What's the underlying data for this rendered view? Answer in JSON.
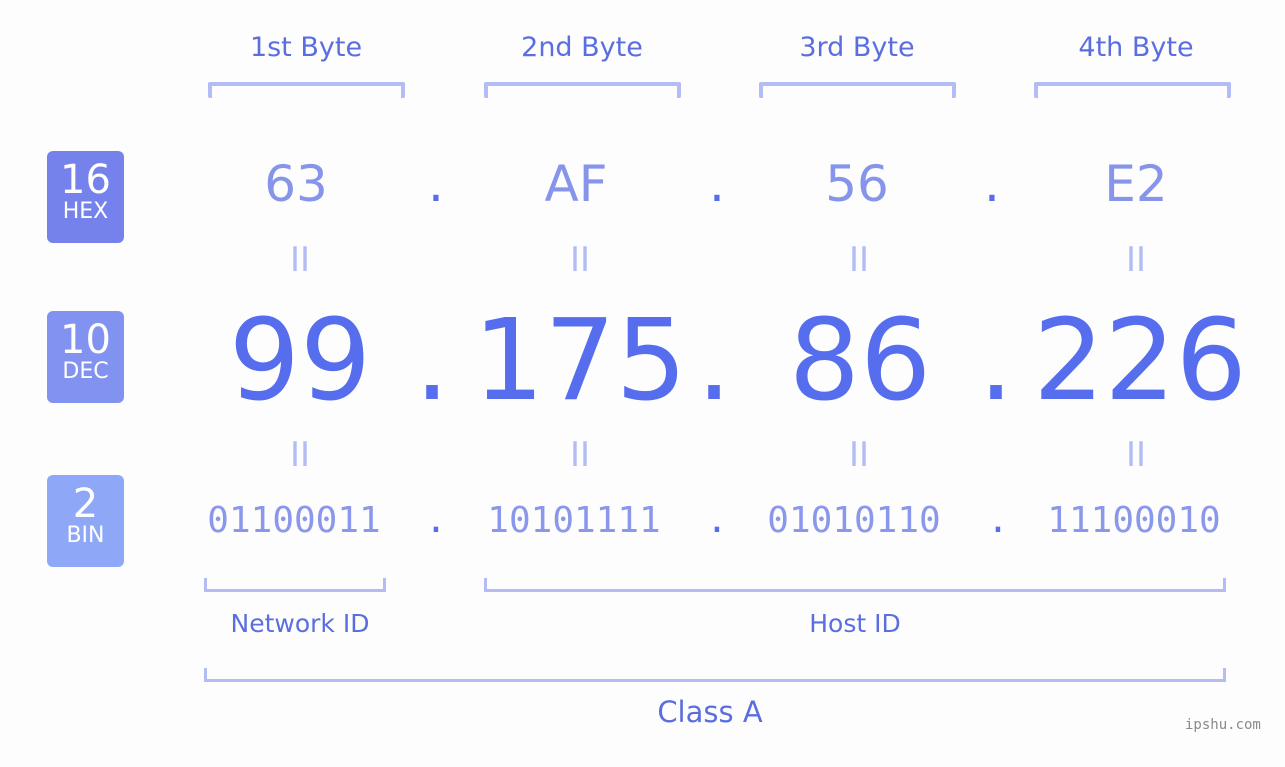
{
  "byte_headers": [
    "1st Byte",
    "2nd Byte",
    "3rd Byte",
    "4th Byte"
  ],
  "badges": [
    {
      "num": "16",
      "label": "HEX",
      "color": "#7582eb"
    },
    {
      "num": "10",
      "label": "DEC",
      "color": "#8292f0"
    },
    {
      "num": "2",
      "label": "BIN",
      "color": "#8fa7f7"
    }
  ],
  "hex": [
    "63",
    "AF",
    "56",
    "E2"
  ],
  "dec": [
    "99",
    "175",
    "86",
    "226"
  ],
  "bin": [
    "01100011",
    "10101111",
    "01010110",
    "11100010"
  ],
  "separator": ".",
  "equals": "II",
  "network_label": "Network ID",
  "host_label": "Host ID",
  "class_label": "Class A",
  "watermark": "ipshu.com",
  "colors": {
    "accent": "#566ded",
    "light": "#b3bcf5",
    "hex_text": "#8694ea",
    "bin_text": "#8a97ea"
  }
}
